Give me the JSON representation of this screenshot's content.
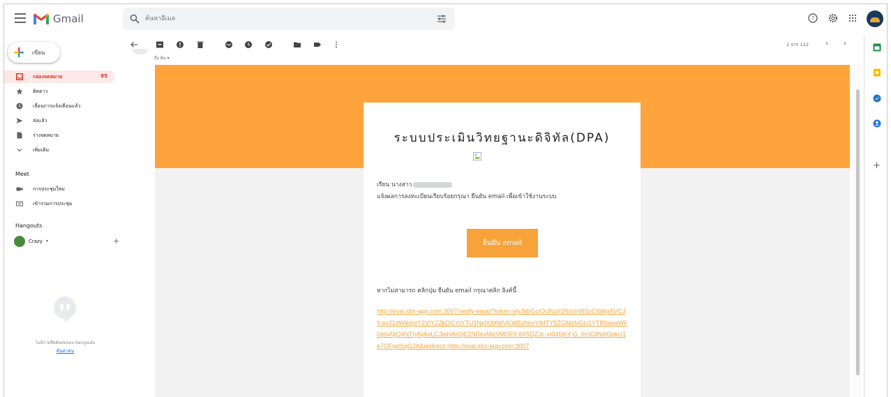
{
  "app": {
    "name": "Gmail"
  },
  "search": {
    "placeholder": "ค้นหาอีเมล"
  },
  "compose": {
    "label": "เขียน"
  },
  "sidebar": {
    "items": [
      {
        "label": "กล่องจดหมาย",
        "count": "85",
        "icon": "inbox-icon"
      },
      {
        "label": "ติดดาว",
        "icon": "star-icon"
      },
      {
        "label": "เลื่อนการแจ้งเตือนแล้ว",
        "icon": "clock-icon"
      },
      {
        "label": "ส่งแล้ว",
        "icon": "send-icon"
      },
      {
        "label": "ร่างจดหมาย",
        "icon": "draft-icon"
      },
      {
        "label": "เพิ่มเติม",
        "icon": "chevron-down-icon"
      }
    ],
    "meet": {
      "title": "Meet",
      "items": [
        {
          "label": "การประชุมใหม่",
          "icon": "video-icon"
        },
        {
          "label": "เข้าร่วมการประชุม",
          "icon": "keyboard-icon"
        }
      ]
    },
    "hangouts": {
      "title": "Hangouts",
      "user": "Crazy",
      "empty_text": "ไม่มีรายชื่อติดต่อของ Hangouts",
      "find_link": "ค้นหาคน"
    }
  },
  "toolbar": {
    "pager_text": "1 จาก 122",
    "prev": "‹",
    "next": "›"
  },
  "message": {
    "to_me": "ถึง ฉัน ▾",
    "title": "ระบบประเมินวิทยฐานะดิจิทัล(DPA)",
    "greeting": "เรียน นางสาว",
    "instruction": "แจ้งผลการลงทะเบียนเรียบร้อยกรุณา ยืนยัน email เพื่อเข้าใช้งานระบบ",
    "confirm_button": "ยืนยัน email",
    "fallback_text": "หากไม่สามารถ คลิกปุ่ม ยืนยัน email กรุณาคลิก ลิงค์นี้",
    "verify_link": "http://eval.sbs-app.com:3007/verify-email?token=eyJhbGciOiJIUzI1NiIsInR5cCI6IkpXVCJ9.eyJ1dWlkIjoiY2VlY2ZkOGYtYTU1Ny00MWVlLWEzNmYtMTY5ZGMzNGU1YTRlIiwiaWF0IjoxNjQ4NTIyNjAxLCJleHAiOjE2NDkxMjc0MDF9.8X5QZJc-xI045j6Y-G_6mCdhdIOqkU1e7OFjwlSqGJA&redirect=http://eval.sbs-app.com:3007"
  },
  "colors": {
    "banner": "#ffa43c",
    "button": "#f7a23b",
    "link": "#f2a640",
    "inbox_active": "#d93025"
  }
}
